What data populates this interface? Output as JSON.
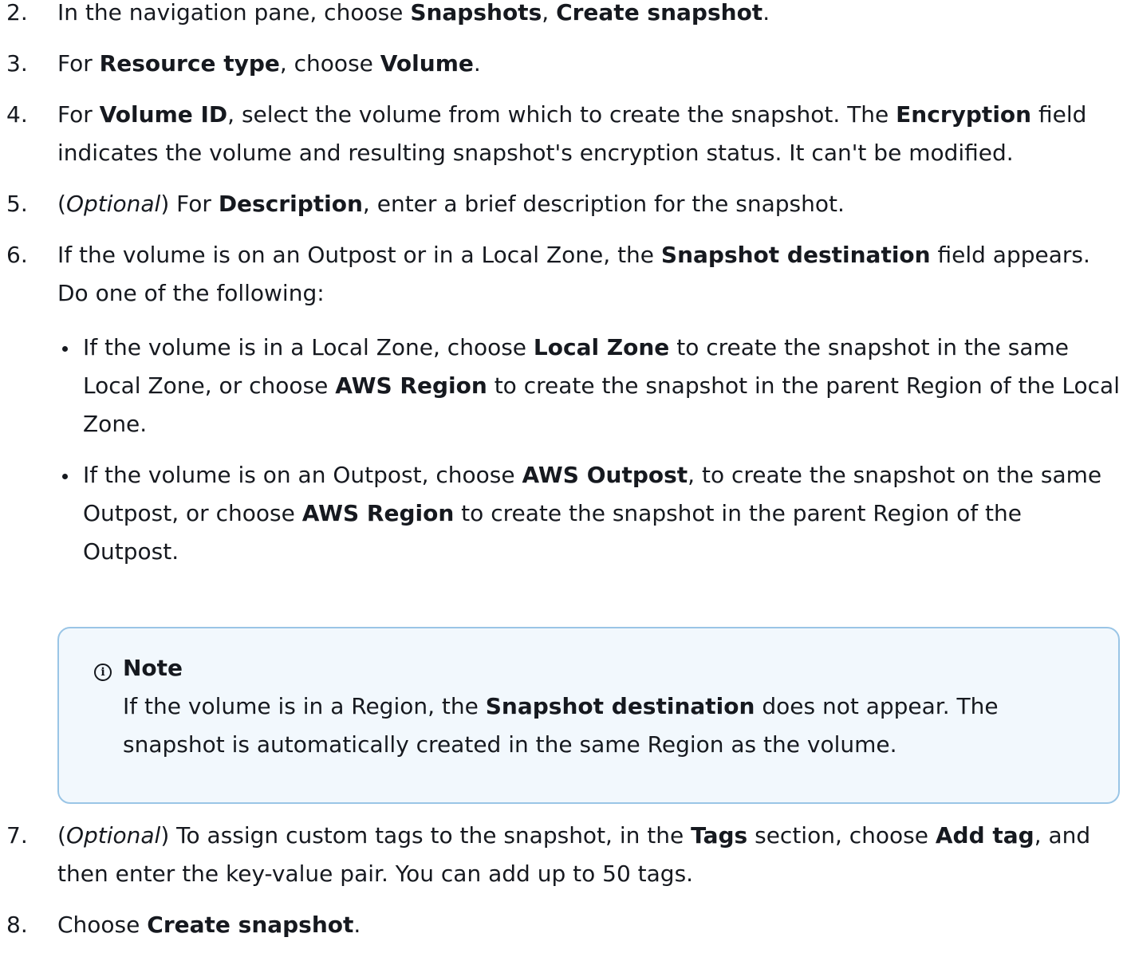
{
  "steps": [
    {
      "num": "2.",
      "parts": [
        "In the navigation pane, choose ",
        "Snapshots",
        ", ",
        "Create snapshot",
        "."
      ]
    },
    {
      "num": "3.",
      "parts": [
        "For ",
        "Resource type",
        ", choose ",
        "Volume",
        "."
      ]
    },
    {
      "num": "4.",
      "parts": [
        "For ",
        "Volume ID",
        ", select the volume from which to create the snapshot. The ",
        "Encryption",
        " field indicates the volume and resulting snapshot's encryption status. It can't be modified."
      ]
    },
    {
      "num": "5.",
      "parts": [
        "(",
        "Optional",
        ") For ",
        "Description",
        ", enter a brief description for the snapshot."
      ]
    },
    {
      "num": "6.",
      "parts": [
        "If the volume is on an Outpost or in a Local Zone, the ",
        "Snapshot destination",
        " field appears. Do one of the following:"
      ],
      "bullets": [
        [
          "If the volume is in a Local Zone, choose ",
          "Local Zone",
          " to create the snapshot in the same Local Zone, or choose ",
          "AWS Region",
          " to create the snapshot in the parent Region of the Local Zone."
        ],
        [
          "If the volume is on an Outpost, choose ",
          "AWS Outpost",
          ", to create the snapshot on the same Outpost, or choose ",
          "AWS Region",
          " to create the snapshot in the parent Region of the Outpost."
        ]
      ]
    },
    {
      "num": "7.",
      "parts": [
        "(",
        "Optional",
        ") To assign custom tags to the snapshot, in the ",
        "Tags",
        " section, choose ",
        "Add tag",
        ", and then enter the key-value pair. You can add up to 50 tags."
      ]
    },
    {
      "num": "8.",
      "parts": [
        "Choose ",
        "Create snapshot",
        "."
      ]
    }
  ],
  "note": {
    "icon": "info-icon",
    "icon_glyph": "i",
    "title": "Note",
    "parts": [
      "If the volume is in a Region, the ",
      "Snapshot destination",
      " does not appear. The snapshot is automatically created in the same Region as the volume."
    ]
  }
}
